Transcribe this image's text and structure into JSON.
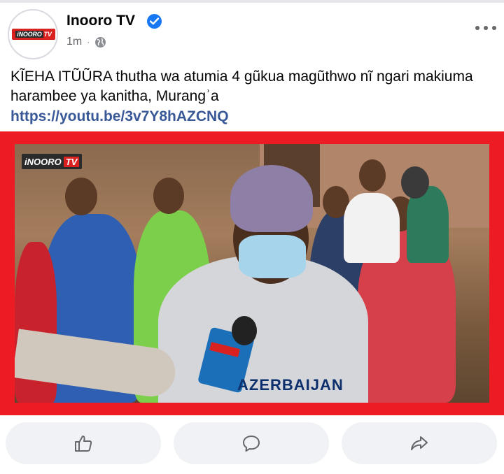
{
  "post": {
    "page_name": "Inooro TV",
    "timestamp": "1m",
    "separator": "·",
    "avatar_logo": {
      "left_text": "iNOORO",
      "right_text": "TV"
    },
    "text": "KĨEHA ITŨŨRA thutha wa atumia 4 gũkua magũthwo nĩ ngari makiuma harambee ya kanitha, Murangʾa",
    "link": "https://youtu.be/3v7Y8hAZCNQ"
  },
  "media": {
    "watermark": {
      "left_text": "iNOORO",
      "right_text": "TV"
    },
    "shirt_text": "AZERBAIJAN",
    "border_color": "#ed1c24"
  },
  "icons": {
    "verified": "verified-badge-icon",
    "audience": "globe-icon",
    "menu": "more-options-icon",
    "like": "thumbs-up-icon",
    "comment": "comment-bubble-icon",
    "share": "share-arrow-icon"
  },
  "colors": {
    "accent": "#1877f2",
    "link": "#385898",
    "muted": "#65676b",
    "button_bg": "#f0f2f5"
  }
}
